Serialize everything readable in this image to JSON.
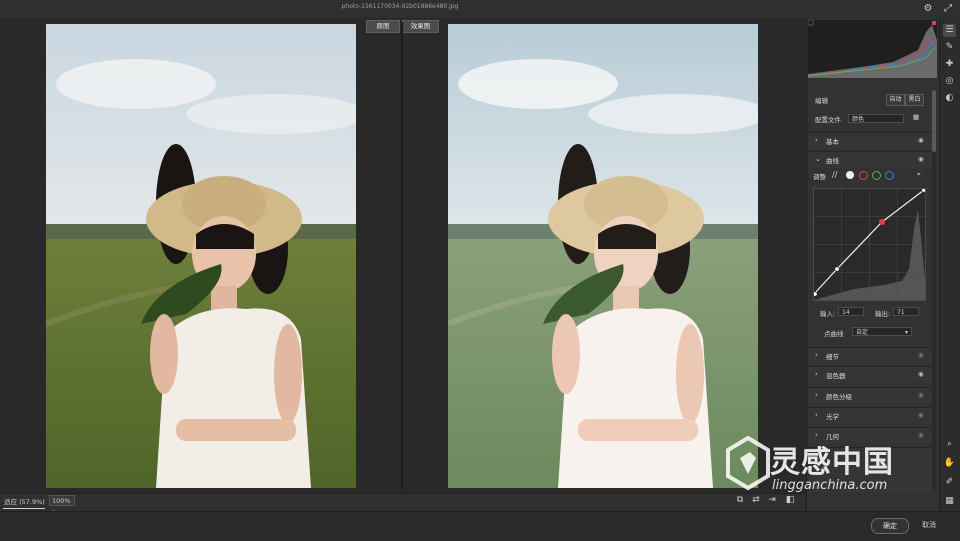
{
  "window": {
    "filename": "photo-1561170034-92b01886e480.jpg"
  },
  "compare": {
    "tab_before": "原图",
    "tab_after": "效果图"
  },
  "status": {
    "zoom_fit": "适应 (57.9%)",
    "zoom_select": "100%"
  },
  "panel": {
    "edit_title": "编辑",
    "auto_label": "自动",
    "bw_label": "黑白",
    "profile_label": "配置文件",
    "profile_value": "颜色",
    "basic_label": "基本",
    "curve_label": "曲线",
    "adjust_label": "调整",
    "input_label": "输入:",
    "input_value": "14",
    "output_label": "输出:",
    "output_value": "71",
    "point_curve_label": "点曲线",
    "point_curve_value": "自定",
    "sections": [
      "细节",
      "混色器",
      "颜色分级",
      "光学",
      "几何"
    ]
  },
  "footer": {
    "ok_label": "确定",
    "cancel_label": "取消"
  },
  "watermark": {
    "brand_cn": "灵感中国",
    "brand_en": "lingganchina.com"
  },
  "colors": {
    "accent_red": "#e0404b",
    "channel_green": "#3fbf4f",
    "channel_blue": "#3f7fe0"
  }
}
